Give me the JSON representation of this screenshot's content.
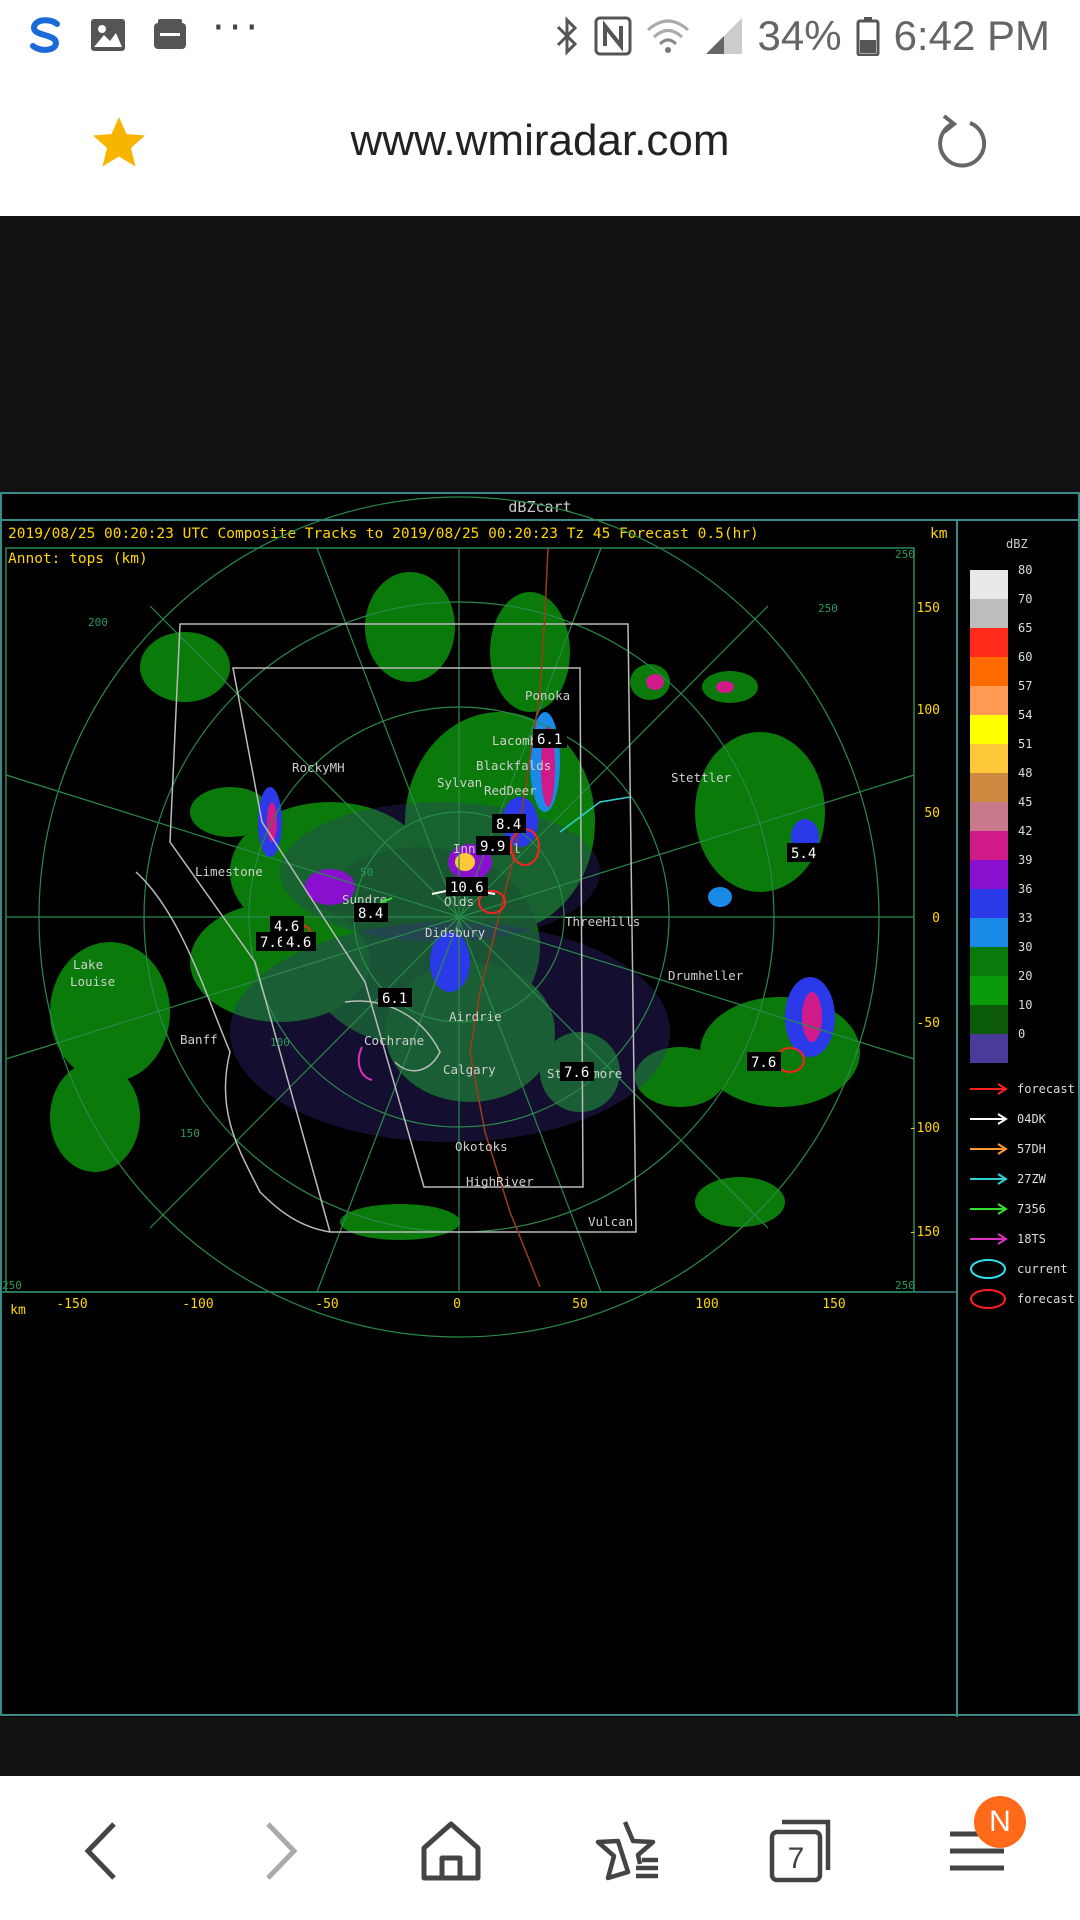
{
  "status_bar": {
    "battery": "34%",
    "time": "6:42 PM",
    "more": "···",
    "icons": [
      "s-app-icon",
      "gallery-icon",
      "archive-icon",
      "bluetooth-icon",
      "nfc-icon",
      "wifi-icon",
      "signal-icon",
      "battery-icon"
    ]
  },
  "browser": {
    "url": "www.wmiradar.com",
    "tab_count": "7",
    "notification_badge": "N"
  },
  "radar": {
    "window_title": "dBZcart",
    "header": "2019/08/25 00:20:23 UTC Composite Tracks to 2019/08/25 00:20:23 Tz 45 Forecast 0.5(hr)",
    "header_unit": "km",
    "annotation": "Annot: tops (km)",
    "axis_unit": "km",
    "x_ticks": [
      "-150",
      "-100",
      "-50",
      "0",
      "50",
      "100",
      "150"
    ],
    "y_ticks": [
      "150",
      "100",
      "50",
      "0",
      "-50",
      "-100",
      "-150"
    ],
    "corner_labels": [
      "250",
      "250",
      "250",
      "250"
    ],
    "ring_labels": [
      "50",
      "100",
      "150",
      "200"
    ],
    "places": [
      "Ponoka",
      "Lacombe",
      "Blackfalds",
      "RedDeer",
      "Sylvan",
      "RockyMH",
      "Stettler",
      "Innisfail",
      "Limestone",
      "Olds",
      "Sundre",
      "Didsbury",
      "ThreeHills",
      "Drumheller",
      "Lake",
      "Louise",
      "Banff",
      "Cochrane",
      "Airdrie",
      "Calgary",
      "Strathmore",
      "Okotoks",
      "HighRiver",
      "Vulcan"
    ],
    "storm_tops": [
      "6.1",
      "8.4",
      "9.9",
      "10.6",
      "8.4",
      "4.6",
      "7.6",
      "4.6",
      "6.1",
      "7.6",
      "5.4",
      "7.6"
    ],
    "legend_title": "dBZ",
    "legend_levels": [
      "80",
      "70",
      "65",
      "60",
      "57",
      "54",
      "51",
      "48",
      "45",
      "42",
      "39",
      "36",
      "33",
      "30",
      "20",
      "10",
      "0"
    ],
    "legend_colors": [
      "#e8e8e8",
      "#bdbdbd",
      "#ff2a1a",
      "#ff6a00",
      "#ff9a55",
      "#ffff00",
      "#ffc83a",
      "#d08a40",
      "#c87a8a",
      "#d01a8a",
      "#8a10d0",
      "#2a3ae8",
      "#1a8ae8",
      "#0a7a0a",
      "#0a9a0a",
      "#0a5a0a",
      "#4a3a9a"
    ],
    "tracks_legend": [
      {
        "label": "forecast",
        "color": "#ff2020",
        "kind": "arrow"
      },
      {
        "label": "04DK",
        "color": "#ffffff",
        "kind": "arrow"
      },
      {
        "label": "57DH",
        "color": "#ff9a30",
        "kind": "arrow"
      },
      {
        "label": "27ZW",
        "color": "#30d0d0",
        "kind": "arrow"
      },
      {
        "label": "7356",
        "color": "#30e030",
        "kind": "arrow"
      },
      {
        "label": "18TS",
        "color": "#e030c0",
        "kind": "arrow"
      },
      {
        "label": "current",
        "color": "#30e0f0",
        "kind": "ellipse"
      },
      {
        "label": "forecast",
        "color": "#ff2020",
        "kind": "ellipse"
      }
    ]
  }
}
